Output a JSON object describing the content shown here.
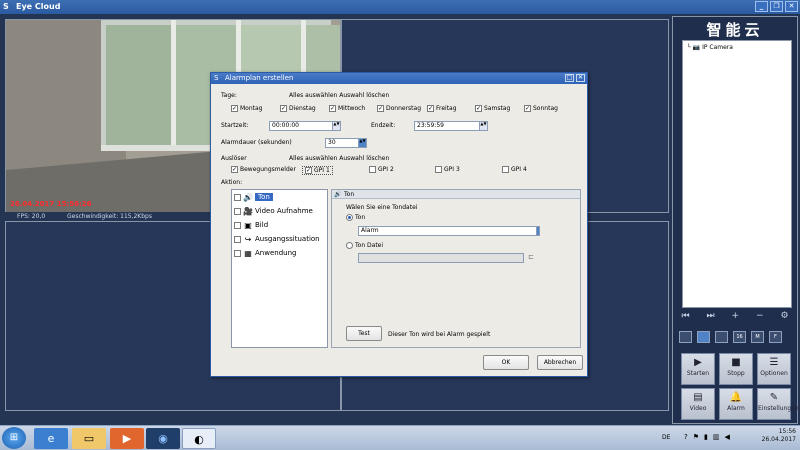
{
  "app": {
    "title": "Eye Cloud",
    "logo_text": "智能云",
    "window_buttons": [
      "_",
      "❐",
      "✕"
    ]
  },
  "video": {
    "timestamp": "26.04.2017 15:56:26",
    "fps": "FPS: 20,0",
    "speed": "Geschwindigkeit: 115,2Kbps"
  },
  "right_panel": {
    "tree_item": "IP Camera",
    "buttons": [
      {
        "label": "Starten",
        "icon": "play-icon"
      },
      {
        "label": "Stopp",
        "icon": "stop-icon"
      },
      {
        "label": "Optionen",
        "icon": "options-icon"
      },
      {
        "label": "Video",
        "icon": "video-icon"
      },
      {
        "label": "Alarm",
        "icon": "bell-icon"
      },
      {
        "label": "Einstellungen",
        "icon": "tools-icon"
      }
    ],
    "layout_labels": [
      "",
      "",
      "",
      "16",
      "M",
      "F"
    ]
  },
  "dialog": {
    "title": "Alarmplan erstellen",
    "tage_label": "Tage:",
    "select_links": "Alles auswählen Auswahl löschen",
    "days": [
      {
        "label": "Montag",
        "checked": true
      },
      {
        "label": "Dienstag",
        "checked": true
      },
      {
        "label": "Mittwoch",
        "checked": true
      },
      {
        "label": "Donnerstag",
        "checked": true
      },
      {
        "label": "Freitag",
        "checked": true
      },
      {
        "label": "Samstag",
        "checked": true
      },
      {
        "label": "Sonntag",
        "checked": true
      }
    ],
    "start_label": "Startzeit:",
    "start_value": "00:00:00",
    "end_label": "Endzeit:",
    "end_value": "23:59:59",
    "duration_label": "Alarmdauer (sekunden)",
    "duration_value": "30",
    "trigger_label": "Auslöser",
    "triggers": [
      {
        "label": "Bewegungsmelder",
        "checked": true
      },
      {
        "label": "GPI 1",
        "checked": true
      },
      {
        "label": "GPI 2",
        "checked": false
      },
      {
        "label": "GPI 3",
        "checked": false
      },
      {
        "label": "GPI 4",
        "checked": false
      }
    ],
    "action_label": "Aktion:",
    "actions": [
      {
        "label": "Ton",
        "icon": "speaker-icon"
      },
      {
        "label": "Video Aufnahme",
        "icon": "camera-icon"
      },
      {
        "label": "Bild",
        "icon": "image-icon"
      },
      {
        "label": "Ausgangssituation",
        "icon": "output-icon"
      },
      {
        "label": "Anwendung",
        "icon": "app-icon"
      }
    ],
    "sub": {
      "header": "Ton",
      "choose_label": "Wälen Sie eine Tondatei",
      "radio_ton": "Ton",
      "sound_value": "Alarm",
      "radio_file": "Ton Datei",
      "test_button": "Test",
      "note": "Dieser Ton wird bei Alarm gespielt"
    },
    "ok": "OK",
    "cancel": "Abbrechen"
  },
  "taskbar": {
    "lang": "DE",
    "time": "15:56",
    "date": "26.04.2017"
  }
}
